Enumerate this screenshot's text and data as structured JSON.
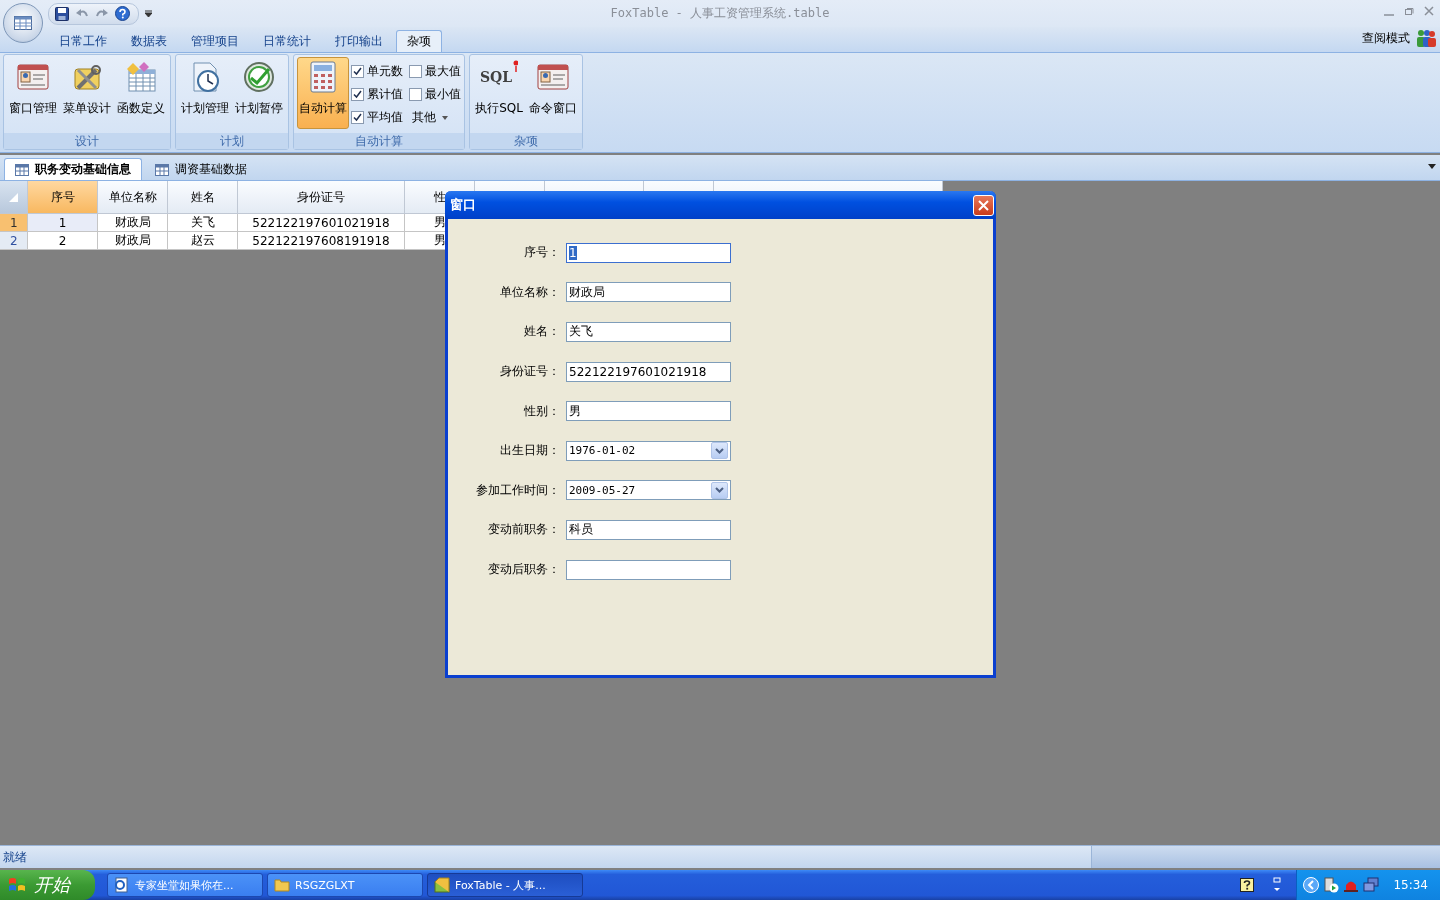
{
  "window": {
    "title": "FoxTable - 人事工资管理系统.table"
  },
  "ribbon_tabs": [
    {
      "label": "日常工作",
      "selected": false
    },
    {
      "label": "数据表",
      "selected": false
    },
    {
      "label": "管理项目",
      "selected": false
    },
    {
      "label": "日常统计",
      "selected": false
    },
    {
      "label": "打印输出",
      "selected": false
    },
    {
      "label": "杂项",
      "selected": true
    }
  ],
  "view_mode": {
    "label": "查阅模式"
  },
  "ribbon_groups": [
    {
      "title": "设计",
      "items": [
        {
          "kind": "large",
          "label": "窗口管理",
          "pressed": false
        },
        {
          "kind": "large",
          "label": "菜单设计",
          "pressed": false
        },
        {
          "kind": "large",
          "label": "函数定义",
          "pressed": false
        }
      ]
    },
    {
      "title": "计划",
      "items": [
        {
          "kind": "large",
          "label": "计划管理",
          "pressed": false
        },
        {
          "kind": "large",
          "label": "计划暂停",
          "pressed": false
        }
      ]
    },
    {
      "title": "自动计算",
      "items": [
        {
          "kind": "large",
          "label": "自动计算",
          "pressed": true
        },
        {
          "kind": "check",
          "label": "单元数",
          "checked": true
        },
        {
          "kind": "check",
          "label": "最大值",
          "checked": false
        },
        {
          "kind": "check",
          "label": "累计值",
          "checked": true
        },
        {
          "kind": "check",
          "label": "最小值",
          "checked": false
        },
        {
          "kind": "check",
          "label": "平均值",
          "checked": true
        },
        {
          "kind": "menu",
          "label": "其他"
        }
      ]
    },
    {
      "title": "杂项",
      "items": [
        {
          "kind": "large",
          "label": "执行SQL",
          "pressed": false,
          "icon_label": "SQL"
        },
        {
          "kind": "large",
          "label": "命令窗口",
          "pressed": false
        }
      ]
    }
  ],
  "sheet_tabs": [
    {
      "label": "职务变动基础信息",
      "selected": true
    },
    {
      "label": "调资基础数据",
      "selected": false
    }
  ],
  "table": {
    "columns": [
      {
        "label": "序号",
        "selected": true
      },
      {
        "label": "单位名称",
        "selected": false
      },
      {
        "label": "姓名",
        "selected": false
      },
      {
        "label": "身份证号",
        "selected": false
      },
      {
        "label": "性",
        "selected": false
      }
    ],
    "rows": [
      {
        "number": "1",
        "selected": true,
        "cells": [
          "1",
          "财政局",
          "关飞",
          "522122197601021918",
          "男"
        ]
      },
      {
        "number": "2",
        "selected": false,
        "cells": [
          "2",
          "财政局",
          "赵云",
          "522122197608191918",
          "男"
        ]
      }
    ]
  },
  "dialog": {
    "title": "窗口",
    "fields": [
      {
        "label": "序号：",
        "kind": "text",
        "value": "1",
        "focused": true
      },
      {
        "label": "单位名称：",
        "kind": "text",
        "value": "财政局",
        "focused": false
      },
      {
        "label": "姓名：",
        "kind": "text",
        "value": "关飞",
        "focused": false
      },
      {
        "label": "身份证号：",
        "kind": "text",
        "value": "522122197601021918",
        "focused": false
      },
      {
        "label": "性别：",
        "kind": "text",
        "value": "男",
        "focused": false
      },
      {
        "label": "出生日期：",
        "kind": "date",
        "value": "1976-01-02",
        "focused": false
      },
      {
        "label": "参加工作时间：",
        "kind": "date",
        "value": "2009-05-27",
        "focused": false
      },
      {
        "label": "变动前职务：",
        "kind": "text",
        "value": "科员",
        "focused": false
      },
      {
        "label": "变动后职务：",
        "kind": "text",
        "focused": false
      }
    ]
  },
  "status_bar": {
    "text": "就绪"
  },
  "taskbar": {
    "start": "开始",
    "tasks": [
      {
        "label": "专家坐堂如果你在...",
        "active": false
      },
      {
        "label": "RSGZGLXT",
        "active": false
      },
      {
        "label": "FoxTable - 人事...",
        "active": true
      }
    ],
    "clock": "15:34"
  }
}
